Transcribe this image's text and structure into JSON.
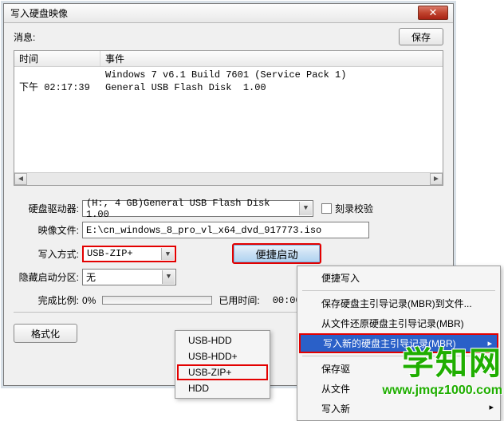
{
  "dialog": {
    "title": "写入硬盘映像",
    "message_label": "消息:",
    "save_button": "保存",
    "log": {
      "col_time": "时间",
      "col_event": "事件",
      "rows": [
        {
          "time": "",
          "event": "Windows 7 v6.1 Build 7601 (Service Pack 1)"
        },
        {
          "time": "下午 02:17:39",
          "event": "General USB Flash Disk  1.00"
        }
      ]
    },
    "drive": {
      "label": "硬盘驱动器:",
      "value": "(H:, 4 GB)General USB Flash Disk  1.00",
      "checkbox": "刻录校验"
    },
    "image_file": {
      "label": "映像文件:",
      "value": "E:\\cn_windows_8_pro_vl_x64_dvd_917773.iso"
    },
    "write_method": {
      "label": "写入方式:",
      "value": "USB-ZIP+",
      "quick_boot_button": "便捷启动"
    },
    "hidden_partition": {
      "label": "隐藏启动分区:",
      "value": "无"
    },
    "progress": {
      "label": "完成比例:",
      "percent": "0%",
      "elapsed_label": "已用时间:",
      "elapsed": "00:00:00"
    },
    "footer": {
      "format": "格式化"
    }
  },
  "main_menu": {
    "items": [
      {
        "label": "便捷写入",
        "arrow": false
      },
      {
        "sep": true
      },
      {
        "label": "保存硬盘主引导记录(MBR)到文件...",
        "arrow": false
      },
      {
        "label": "从文件还原硬盘主引导记录(MBR)",
        "arrow": false
      },
      {
        "label": "写入新的硬盘主引导记录(MBR)",
        "arrow": true,
        "highlight": true
      },
      {
        "sep": true
      },
      {
        "label": "保存驱",
        "arrow": false
      },
      {
        "label": "从文件",
        "arrow": false
      },
      {
        "label": "写入新",
        "arrow": true
      }
    ]
  },
  "sub_menu": {
    "items": [
      {
        "label": "USB-HDD"
      },
      {
        "label": "USB-HDD+"
      },
      {
        "label": "USB-ZIP+",
        "selected": true
      },
      {
        "label": "HDD"
      }
    ]
  },
  "watermark": {
    "brand": "学知网",
    "url": "www.jmqz1000.com"
  }
}
